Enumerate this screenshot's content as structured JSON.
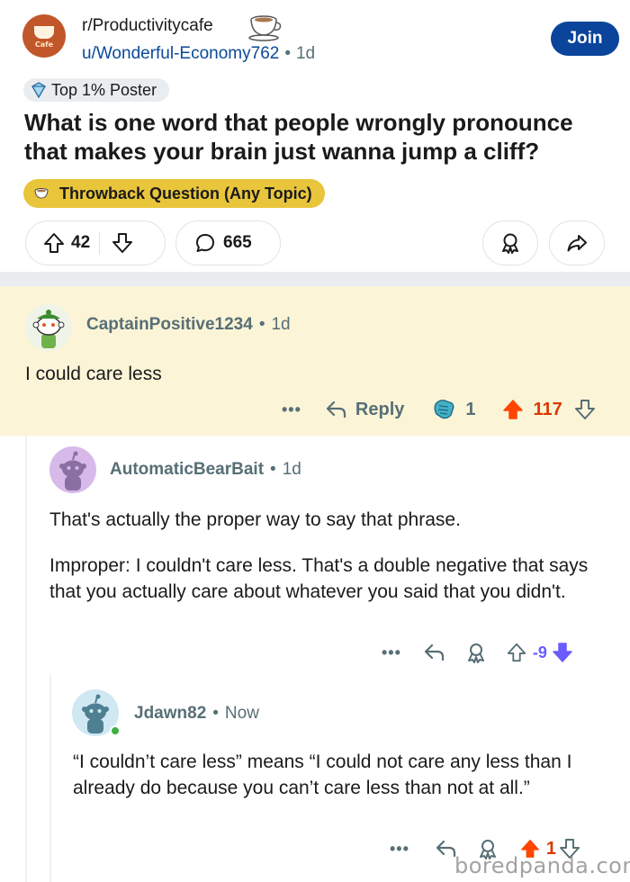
{
  "post": {
    "subreddit": "r/Productivitycafe",
    "author": "u/Wonderful-Economy762",
    "age": "1d",
    "join_label": "Join",
    "user_flair": "Top 1% Poster",
    "title": "What is one word that people wrongly pronounce that makes your brain just wanna jump a cliff?",
    "post_flair": "Throwback Question (Any Topic)",
    "upvotes": "42",
    "comments": "665",
    "logo_text": "Cafe"
  },
  "comments": [
    {
      "author": "CaptainPositive1234",
      "age": "1d",
      "paragraphs": [
        "I could care less"
      ],
      "reply_label": "Reply",
      "award_count": "1",
      "score": "117",
      "more": "•••"
    },
    {
      "author": "AutomaticBearBait",
      "age": "1d",
      "paragraphs": [
        "That's actually the proper way to say that phrase.",
        "Improper: I couldn't care less. That's a double negative that says that you actually care about whatever you said that you didn't."
      ],
      "score": "-9",
      "more": "•••"
    },
    {
      "author": "Jdawn82",
      "age": "Now",
      "paragraphs": [
        "“I couldn’t care less” means “I could not care any less than I already do because you can’t care less than not at all.”"
      ],
      "score": "1",
      "more": "•••"
    }
  ],
  "watermark": "boredpanda.com",
  "colors": {
    "join_bg": "#0a449b",
    "post_flair_bg": "#e8c53a",
    "highlight_bg": "#fbf4d7",
    "upvoted": "#ff4500",
    "downvoted": "#6a5cff",
    "link": "#0a4a99"
  },
  "icons": [
    "cafe-logo-icon",
    "coffee-cup-icon",
    "shield-icon",
    "upvote-icon",
    "downvote-icon",
    "comment-icon",
    "award-icon",
    "share-icon",
    "reply-icon",
    "snoo-avatar-icon"
  ]
}
